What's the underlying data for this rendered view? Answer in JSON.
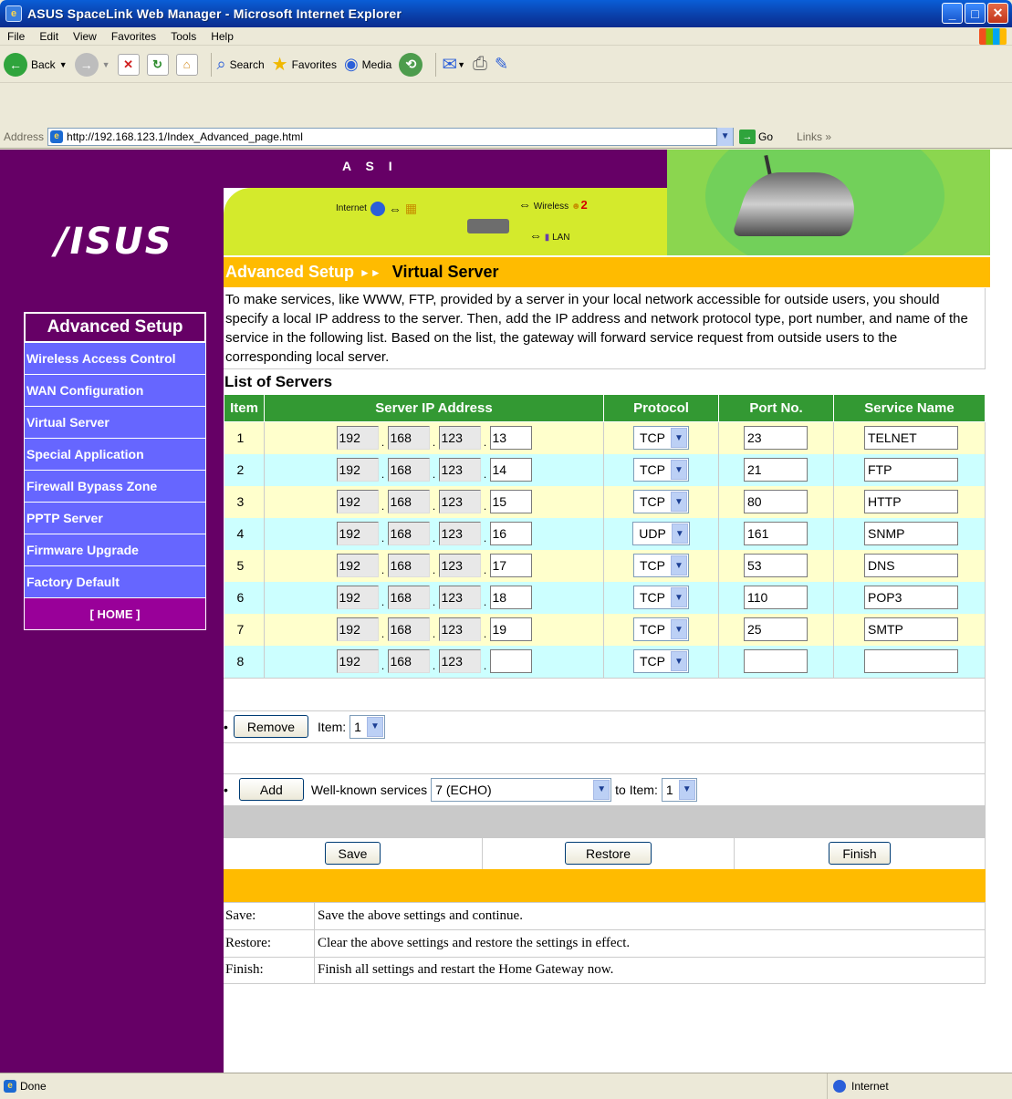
{
  "window": {
    "title": "ASUS SpaceLink Web Manager - Microsoft Internet Explorer"
  },
  "menubar": [
    "File",
    "Edit",
    "View",
    "Favorites",
    "Tools",
    "Help"
  ],
  "toolbar": {
    "back": "Back",
    "search": "Search",
    "favorites": "Favorites",
    "media": "Media"
  },
  "address": {
    "label": "Address",
    "url": "http://192.168.123.1/Index_Advanced_page.html",
    "go": "Go",
    "links": "Links"
  },
  "banner": {
    "logo": "/ISUS",
    "asi": "A S I",
    "internet": "Internet",
    "wireless": "Wireless",
    "wireless_count": "2",
    "lan": "LAN"
  },
  "heading": {
    "section": "Advanced Setup",
    "arrows": "►►",
    "page": "Virtual Server"
  },
  "sidebar": {
    "title": "Advanced Setup",
    "items": [
      "Wireless Access Control",
      "WAN Configuration",
      "Virtual Server",
      "Special Application",
      "Firewall Bypass Zone",
      "PPTP Server",
      "Firmware Upgrade",
      "Factory Default"
    ],
    "home": "[ HOME ]"
  },
  "description": "To make services, like WWW, FTP, provided by a server in your local network accessible for outside users, you should specify a local IP address to the server. Then, add the IP address and network protocol type, port number, and name of the service in the following list. Based on the list, the gateway will forward service request from outside users to the corresponding local server.",
  "list_title": "List of Servers",
  "table": {
    "headers": [
      "Item",
      "Server IP Address",
      "Protocol",
      "Port No.",
      "Service Name"
    ],
    "rows": [
      {
        "item": "1",
        "ip": [
          "192",
          "168",
          "123",
          "13"
        ],
        "protocol": "TCP",
        "port": "23",
        "service": "TELNET"
      },
      {
        "item": "2",
        "ip": [
          "192",
          "168",
          "123",
          "14"
        ],
        "protocol": "TCP",
        "port": "21",
        "service": "FTP"
      },
      {
        "item": "3",
        "ip": [
          "192",
          "168",
          "123",
          "15"
        ],
        "protocol": "TCP",
        "port": "80",
        "service": "HTTP"
      },
      {
        "item": "4",
        "ip": [
          "192",
          "168",
          "123",
          "16"
        ],
        "protocol": "UDP",
        "port": "161",
        "service": "SNMP"
      },
      {
        "item": "5",
        "ip": [
          "192",
          "168",
          "123",
          "17"
        ],
        "protocol": "TCP",
        "port": "53",
        "service": "DNS"
      },
      {
        "item": "6",
        "ip": [
          "192",
          "168",
          "123",
          "18"
        ],
        "protocol": "TCP",
        "port": "110",
        "service": "POP3"
      },
      {
        "item": "7",
        "ip": [
          "192",
          "168",
          "123",
          "19"
        ],
        "protocol": "TCP",
        "port": "25",
        "service": "SMTP"
      },
      {
        "item": "8",
        "ip": [
          "192",
          "168",
          "123",
          ""
        ],
        "protocol": "TCP",
        "port": "",
        "service": ""
      }
    ]
  },
  "remove": {
    "bullet": "•",
    "button": "Remove",
    "item_label": "Item:",
    "item_value": "1"
  },
  "add": {
    "bullet": "•",
    "button": "Add",
    "services_label": "Well-known services",
    "services_value": "7 (ECHO)",
    "to_item_label": "to Item:",
    "to_item_value": "1"
  },
  "actions": {
    "save": "Save",
    "restore": "Restore",
    "finish": "Finish"
  },
  "help": [
    {
      "key": "Save:",
      "text": "Save the above settings and continue."
    },
    {
      "key": "Restore:",
      "text": "Clear the above settings and restore the settings in effect."
    },
    {
      "key": "Finish:",
      "text": "Finish all settings and restart the Home Gateway now."
    }
  ],
  "status": {
    "text": "Done",
    "zone": "Internet"
  }
}
